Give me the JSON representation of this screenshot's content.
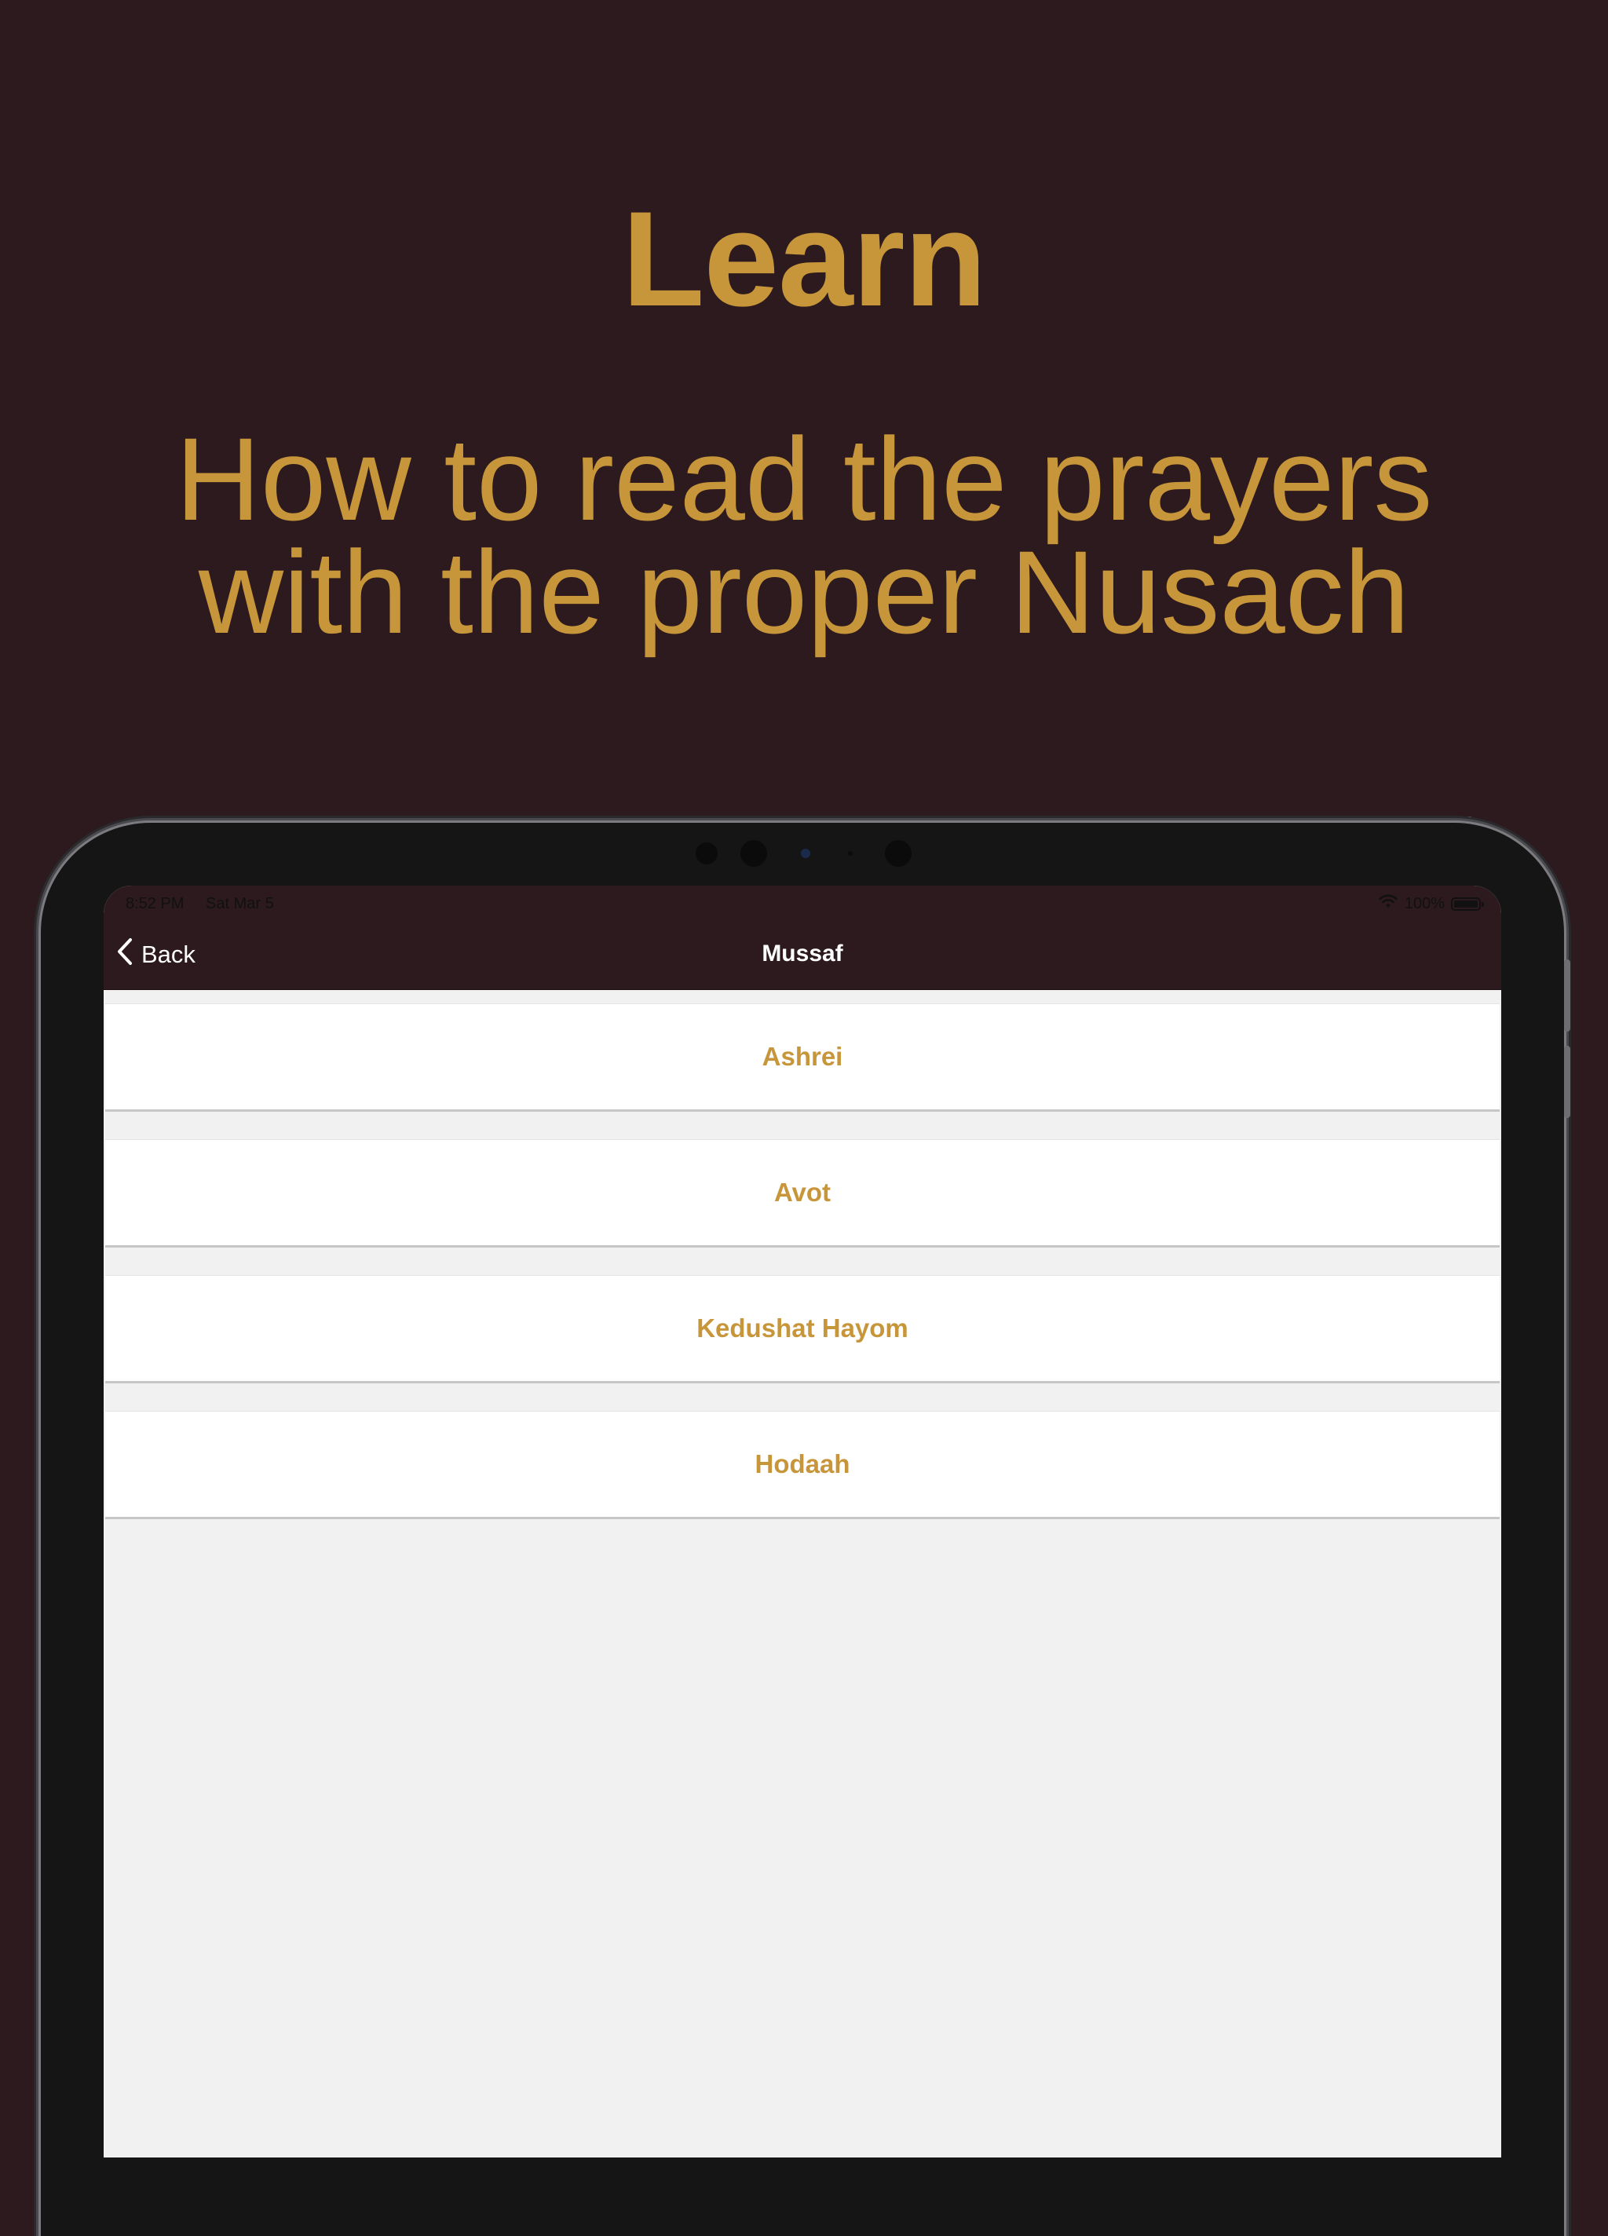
{
  "promo": {
    "headline": "Learn",
    "subheadline_line1": "How to read the prayers",
    "subheadline_line2": "with the proper Nusach"
  },
  "status_bar": {
    "time": "8:52 PM",
    "date": "Sat Mar 5",
    "battery": "100%"
  },
  "nav": {
    "back_label": "Back",
    "title": "Mussaf"
  },
  "items": [
    {
      "label": "Ashrei"
    },
    {
      "label": "Avot"
    },
    {
      "label": "Kedushat Hayom"
    },
    {
      "label": "Hodaah"
    }
  ],
  "colors": {
    "background": "#2c1a1e",
    "accent_gold": "#c8963a",
    "list_background": "#f1f1f1",
    "cell_background": "#ffffff"
  }
}
